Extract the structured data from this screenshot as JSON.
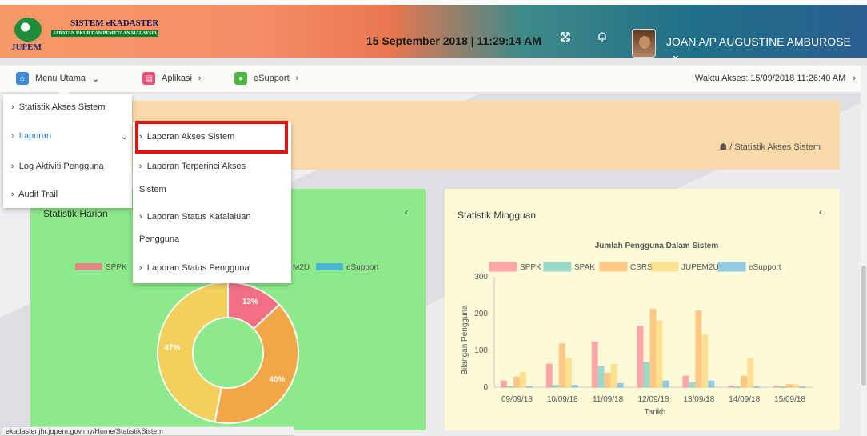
{
  "header": {
    "logo_title": "SISTEM eKADASTER",
    "logo_subtitle": "JABATAN UKUR DAN PEMETAAN MALAYSIA",
    "logo_brand": "JUPEM",
    "datetime": "15 September 2018 | 11:29:14 AM",
    "username": "JOAN A/P AUGUSTINE AMBUROSE"
  },
  "nav": {
    "items": [
      {
        "label": "Menu Utama"
      },
      {
        "label": "Aplikasi"
      },
      {
        "label": "eSupport"
      }
    ],
    "waktu_akses": "Waktu Akses: 15/09/2018 11:26:40 AM"
  },
  "menu_utama": {
    "items": [
      {
        "label": "Statistik Akses Sistem"
      },
      {
        "label": "Laporan"
      },
      {
        "label": "Log Aktiviti Pengguna"
      },
      {
        "label": "Audit Trail"
      }
    ]
  },
  "laporan_submenu": {
    "items": [
      {
        "label": "Laporan Akses Sistem"
      },
      {
        "label": "Laporan Terperinci Akses",
        "line2": "Sistem"
      },
      {
        "label": "Laporan Status Katalaluan",
        "line2": "Pengguna"
      },
      {
        "label": "Laporan Status Pengguna"
      }
    ]
  },
  "breadcrumb": {
    "current": "Statistik Akses Sistem"
  },
  "panel_harian": {
    "title": "Statistik Harian",
    "legend_visible": [
      "SPPK",
      "M2U",
      "eSupport"
    ]
  },
  "panel_mingguan": {
    "title": "Statistik Mingguan"
  },
  "statusbar": "ekadaster.jhr.jupem.gov.my/Home/StatistikSistem",
  "colors": {
    "sppk": "#ff6384",
    "spak": "#4bc0c0",
    "csrs": "#ff9f40",
    "jupem2u": "#ffcd56",
    "esupport": "#36a2eb"
  },
  "chart_data": [
    {
      "type": "pie",
      "categories": [
        "SPPK",
        "CSRS",
        "JUPEM2U"
      ],
      "values": [
        13,
        40,
        47
      ],
      "data_labels": [
        "13%",
        "40%",
        "47%"
      ]
    },
    {
      "type": "bar",
      "title": "Jumlah Pengguna Dalam Sistem",
      "xlabel": "Tarikh",
      "ylabel": "Bilangan Pengguna",
      "categories": [
        "09/09/18",
        "10/09/18",
        "11/09/18",
        "12/09/18",
        "13/09/18",
        "14/09/18",
        "15/09/18"
      ],
      "ylim": [
        0,
        300
      ],
      "yticks": [
        0,
        100,
        200,
        300
      ],
      "series": [
        {
          "name": "SPPK",
          "values": [
            17,
            63,
            123,
            165,
            30,
            3,
            2
          ]
        },
        {
          "name": "SPAK",
          "values": [
            2,
            5,
            57,
            67,
            13,
            0,
            0
          ]
        },
        {
          "name": "CSRS",
          "values": [
            28,
            118,
            38,
            212,
            207,
            30,
            7
          ]
        },
        {
          "name": "JUPEM2U",
          "values": [
            40,
            78,
            62,
            180,
            143,
            78,
            7
          ]
        },
        {
          "name": "eSupport",
          "values": [
            2,
            5,
            10,
            17,
            17,
            0,
            0
          ]
        }
      ]
    }
  ]
}
